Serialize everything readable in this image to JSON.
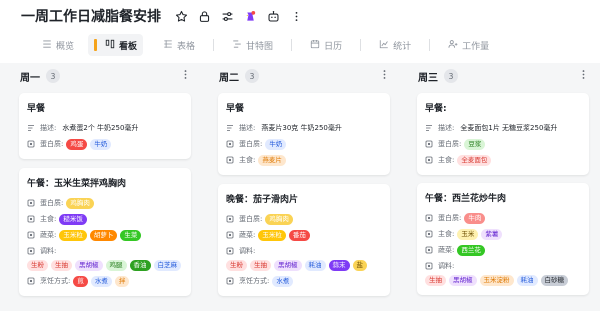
{
  "header": {
    "title": "一周工作日减脂餐安排"
  },
  "tabs": [
    {
      "label": "概览",
      "icon": "grid-icon"
    },
    {
      "label": "看板",
      "icon": "kanban-icon",
      "active": true
    },
    {
      "label": "表格",
      "icon": "table-icon"
    },
    {
      "label": "甘特图",
      "icon": "gantt-icon"
    },
    {
      "label": "日历",
      "icon": "calendar-icon"
    },
    {
      "label": "统计",
      "icon": "chart-icon"
    },
    {
      "label": "工作量",
      "icon": "workload-icon"
    }
  ],
  "colors": {
    "red": "#f54a45",
    "blue_bg": "#e1eaff",
    "blue_fg": "#245bdb",
    "yellow_bg": "#fad355",
    "orange": "#ff8800",
    "green": "#34c724",
    "purple": "#7f3bf5",
    "pink_bg": "#ffe0e0",
    "pink_fg": "#d83931",
    "peach_bg": "#fee7cd",
    "peach_fg": "#de7802",
    "lilac_bg": "#efe0fd",
    "lilac_fg": "#6425d0",
    "teal": "#14c0ff",
    "gray_bg": "#e4e6ea",
    "accent": "#f5a31a"
  },
  "columns": [
    {
      "name": "周一",
      "count": "3",
      "cards": [
        {
          "title": "早餐",
          "fields": [
            {
              "type": "text",
              "name": "描述:",
              "value": "水煮蛋2个 牛奶250毫升"
            },
            {
              "type": "tags",
              "name": "蛋白质:",
              "tags": [
                {
                  "text": "鸡蛋",
                  "bg": "#f54a45",
                  "fg": "#ffffff"
                },
                {
                  "text": "牛奶",
                  "bg": "#e1eaff",
                  "fg": "#245bdb"
                }
              ]
            }
          ]
        },
        {
          "title": "午餐：玉米生菜拌鸡胸肉",
          "fields": [
            {
              "type": "tags",
              "name": "蛋白质:",
              "tags": [
                {
                  "text": "鸡胸肉",
                  "bg": "#fad355",
                  "fg": "#ffffff"
                }
              ]
            },
            {
              "type": "tags",
              "name": "主食:",
              "tags": [
                {
                  "text": "糙米饭",
                  "bg": "#7f3bf5",
                  "fg": "#ffffff"
                }
              ]
            },
            {
              "type": "tags",
              "name": "蔬菜:",
              "tags": [
                {
                  "text": "玉米粒",
                  "bg": "#ffc60a",
                  "fg": "#ffffff"
                },
                {
                  "text": "胡萝卜",
                  "bg": "#ff8800",
                  "fg": "#ffffff"
                },
                {
                  "text": "生菜",
                  "bg": "#34c724",
                  "fg": "#ffffff"
                }
              ]
            },
            {
              "type": "label",
              "name": "调料:",
              "tags": [
                {
                  "text": "生粉",
                  "bg": "#ffe0e0",
                  "fg": "#d83931"
                },
                {
                  "text": "生抽",
                  "bg": "#ffe0e0",
                  "fg": "#d83931"
                },
                {
                  "text": "黑胡椒",
                  "bg": "#efe0fd",
                  "fg": "#6425d0"
                },
                {
                  "text": "鸡腿",
                  "bg": "#d9f5d6",
                  "fg": "#237b19"
                },
                {
                  "text": "香油",
                  "bg": "#2ea121",
                  "fg": "#ffffff"
                },
                {
                  "text": "白芝麻",
                  "bg": "#e1eaff",
                  "fg": "#245bdb"
                }
              ]
            },
            {
              "type": "tags",
              "name": "烹饪方式:",
              "tags": [
                {
                  "text": "煎",
                  "bg": "#f54a45",
                  "fg": "#ffffff"
                },
                {
                  "text": "水煮",
                  "bg": "#e1eaff",
                  "fg": "#245bdb"
                },
                {
                  "text": "拌",
                  "bg": "#fee7cd",
                  "fg": "#de7802"
                }
              ]
            }
          ]
        }
      ]
    },
    {
      "name": "周二",
      "count": "3",
      "cards": [
        {
          "title": "早餐",
          "fields": [
            {
              "type": "text",
              "name": "描述:",
              "value": "燕麦片30克 牛奶250毫升"
            },
            {
              "type": "tags",
              "name": "蛋白质:",
              "tags": [
                {
                  "text": "牛奶",
                  "bg": "#e1eaff",
                  "fg": "#245bdb"
                }
              ]
            },
            {
              "type": "tags",
              "name": "主食:",
              "tags": [
                {
                  "text": "燕麦片",
                  "bg": "#fee7cd",
                  "fg": "#de7802"
                }
              ]
            }
          ]
        },
        {
          "title": "晚餐：茄子滑肉片",
          "fields": [
            {
              "type": "tags",
              "name": "蛋白质:",
              "tags": [
                {
                  "text": "鸡胸肉",
                  "bg": "#fad355",
                  "fg": "#ffffff"
                }
              ]
            },
            {
              "type": "tags",
              "name": "蔬菜:",
              "tags": [
                {
                  "text": "玉米粒",
                  "bg": "#ffc60a",
                  "fg": "#ffffff"
                },
                {
                  "text": "番茄",
                  "bg": "#f54a45",
                  "fg": "#ffffff"
                }
              ]
            },
            {
              "type": "label",
              "name": "调料:",
              "tags": [
                {
                  "text": "生粉",
                  "bg": "#ffe0e0",
                  "fg": "#d83931"
                },
                {
                  "text": "生抽",
                  "bg": "#ffe0e0",
                  "fg": "#d83931"
                },
                {
                  "text": "黑胡椒",
                  "bg": "#efe0fd",
                  "fg": "#6425d0"
                },
                {
                  "text": "耗油",
                  "bg": "#e1eaff",
                  "fg": "#245bdb"
                },
                {
                  "text": "蒜末",
                  "bg": "#7f3bf5",
                  "fg": "#ffffff"
                },
                {
                  "text": "盐",
                  "bg": "#fad355",
                  "fg": "#6b4c00"
                }
              ]
            },
            {
              "type": "tags",
              "name": "烹饪方式:",
              "tags": [
                {
                  "text": "水煮",
                  "bg": "#e1eaff",
                  "fg": "#245bdb"
                }
              ]
            }
          ]
        }
      ]
    },
    {
      "name": "周三",
      "count": "3",
      "cards": [
        {
          "title": "早餐:",
          "fields": [
            {
              "type": "text",
              "name": "描述:",
              "value": "全麦面包1片 无糖豆浆250毫升"
            },
            {
              "type": "tags",
              "name": "蛋白质:",
              "tags": [
                {
                  "text": "豆浆",
                  "bg": "#d9f5d6",
                  "fg": "#237b19"
                }
              ]
            },
            {
              "type": "tags",
              "name": "主食:",
              "tags": [
                {
                  "text": "全麦面包",
                  "bg": "#ffe0e0",
                  "fg": "#d83931"
                }
              ]
            }
          ]
        },
        {
          "title": "午餐：西兰花炒牛肉",
          "fields": [
            {
              "type": "tags",
              "name": "蛋白质:",
              "tags": [
                {
                  "text": "牛肉",
                  "bg": "#f98e8b",
                  "fg": "#ffffff"
                }
              ]
            },
            {
              "type": "tags",
              "name": "主食:",
              "tags": [
                {
                  "text": "玉米",
                  "bg": "#fef1b0",
                  "fg": "#6b4c00"
                },
                {
                  "text": "紫薯",
                  "bg": "#efe0fd",
                  "fg": "#6425d0"
                }
              ]
            },
            {
              "type": "tags",
              "name": "蔬菜:",
              "tags": [
                {
                  "text": "西兰花",
                  "bg": "#34c724",
                  "fg": "#ffffff"
                }
              ]
            },
            {
              "type": "label",
              "name": "调料:",
              "tags": [
                {
                  "text": "生抽",
                  "bg": "#ffe0e0",
                  "fg": "#d83931"
                },
                {
                  "text": "黑胡椒",
                  "bg": "#efe0fd",
                  "fg": "#6425d0"
                },
                {
                  "text": "玉米淀粉",
                  "bg": "#fee7cd",
                  "fg": "#de7802"
                },
                {
                  "text": "耗油",
                  "bg": "#e1eaff",
                  "fg": "#245bdb"
                },
                {
                  "text": "白砂糖",
                  "bg": "#c8cdd6",
                  "fg": "#1f2329"
                }
              ]
            }
          ]
        }
      ]
    }
  ]
}
